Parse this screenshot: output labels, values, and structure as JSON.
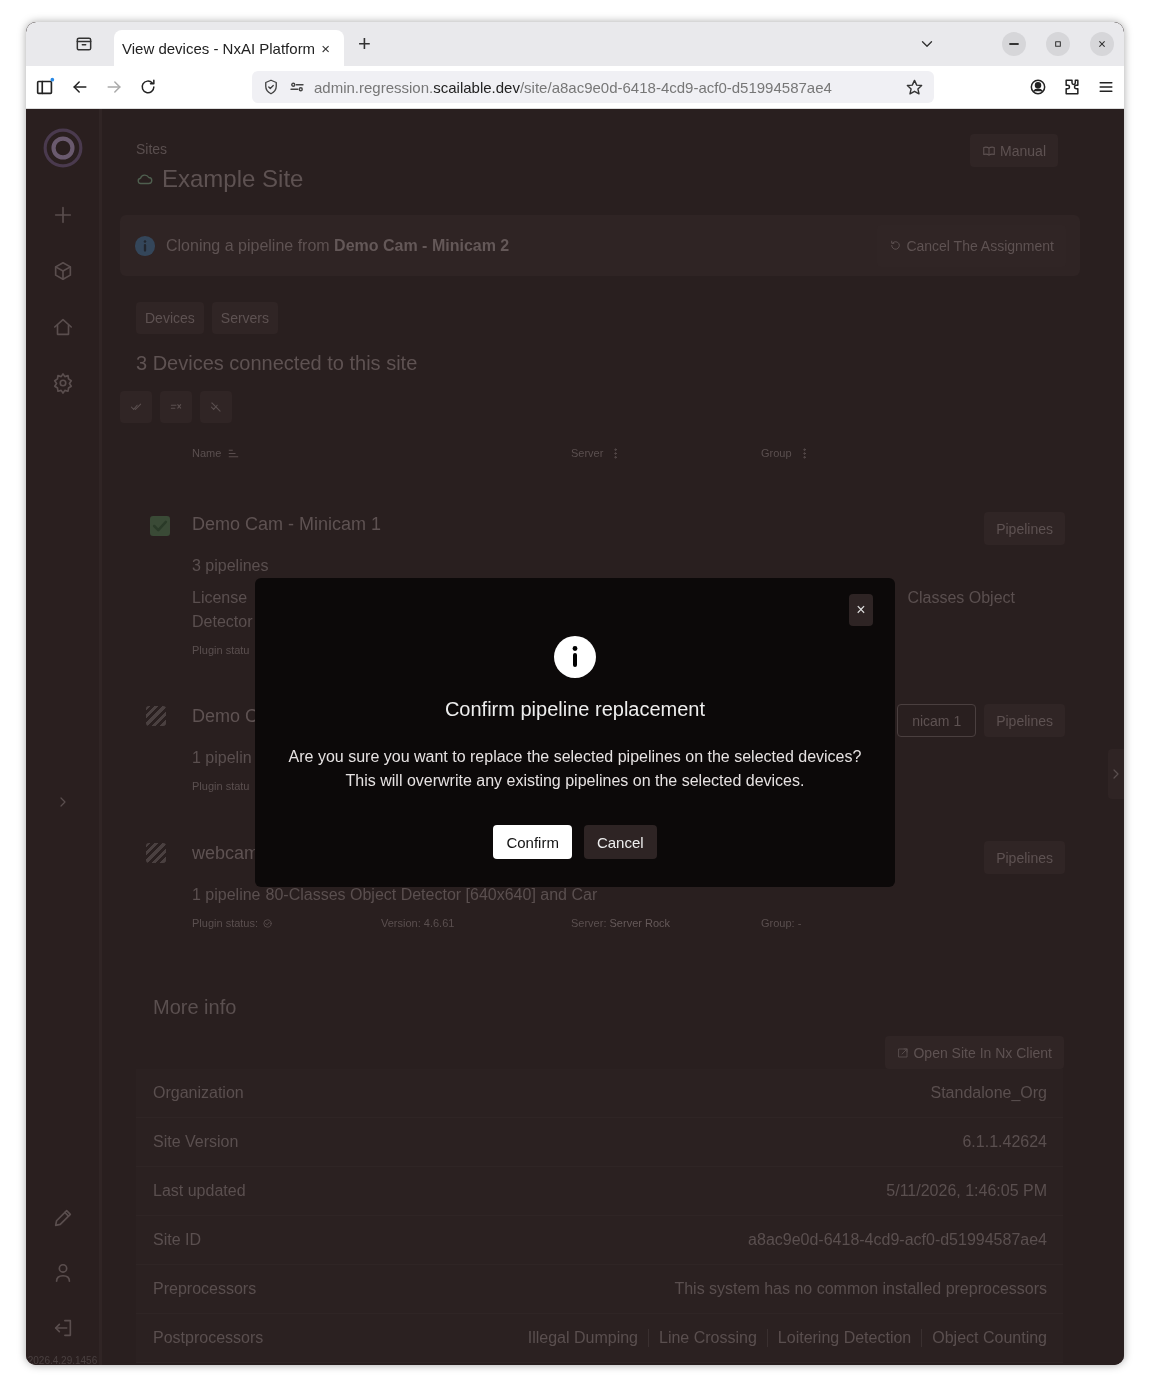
{
  "browser": {
    "tab_title": "View devices - NxAI Platform",
    "close_tab": "×",
    "new_tab": "+",
    "url_prefix": "admin.regression.",
    "url_domain": "scailable.dev",
    "url_path": "/site/a8ac9e0d-6418-4cd9-acf0-d51994587ae4"
  },
  "sidebar": {
    "version": "2026.4.29.1456"
  },
  "header": {
    "breadcrumb": "Sites",
    "title": "Example Site",
    "manual_button": "Manual"
  },
  "banner": {
    "message": "Cloning a pipeline from **Demo Cam - Minicam 2**",
    "cancel_button": "Cancel The Assignment"
  },
  "tabs": [
    {
      "label": "Devices"
    },
    {
      "label": "Servers"
    }
  ],
  "devices_heading": "3 Devices connected to this site",
  "columns": [
    {
      "label": "Name"
    },
    {
      "label": "Server"
    },
    {
      "label": "Group"
    }
  ],
  "devices": [
    {
      "name": "Demo Cam - Minicam 1",
      "checked": true,
      "pipeline_count": "3 pipelines",
      "pipeline_lines": [
        "License",
        "Detector"
      ],
      "pipeline_right": "Classes Object",
      "plugin_status": "Plugin statu",
      "pipelines_button": "Pipelines"
    },
    {
      "name": "Demo C",
      "checked": false,
      "pipeline_count": "1 pipelin",
      "plugin_status": "Plugin statu",
      "source_button": "nicam 1",
      "pipelines_button": "Pipelines"
    },
    {
      "name": "webcam",
      "checked": false,
      "pipeline_count": "1 pipeline",
      "pipeline_names": "80-Classes Object Detector [640x640] and Car",
      "plugin_status": "Plugin status:",
      "version": "Version: 4.6.61",
      "server_label": "Server:",
      "server": "Server Rock",
      "group": "Group: -",
      "pipelines_button": "Pipelines"
    }
  ],
  "more_info": {
    "title": "More info",
    "open_button": "Open Site In Nx Client",
    "rows": [
      {
        "label": "Organization",
        "value": "Standalone_Org"
      },
      {
        "label": "Site Version",
        "value": "6.1.1.42624"
      },
      {
        "label": "Last updated",
        "value": "5/11/2026, 1:46:05 PM"
      },
      {
        "label": "Site ID",
        "value": "a8ac9e0d-6418-4cd9-acf0-d51994587ae4"
      },
      {
        "label": "Preprocessors",
        "value": "This system has no common installed preprocessors"
      },
      {
        "label": "Postprocessors",
        "values": [
          "Illegal Dumping",
          "Line Crossing",
          "Loitering Detection",
          "Object Counting"
        ]
      }
    ]
  },
  "modal": {
    "close": "×",
    "title": "Confirm pipeline replacement",
    "lines": [
      "Are you sure you want to replace the selected pipelines on the selected devices?",
      "This will overwrite any existing pipelines on the selected devices."
    ],
    "confirm": "Confirm",
    "cancel": "Cancel"
  }
}
